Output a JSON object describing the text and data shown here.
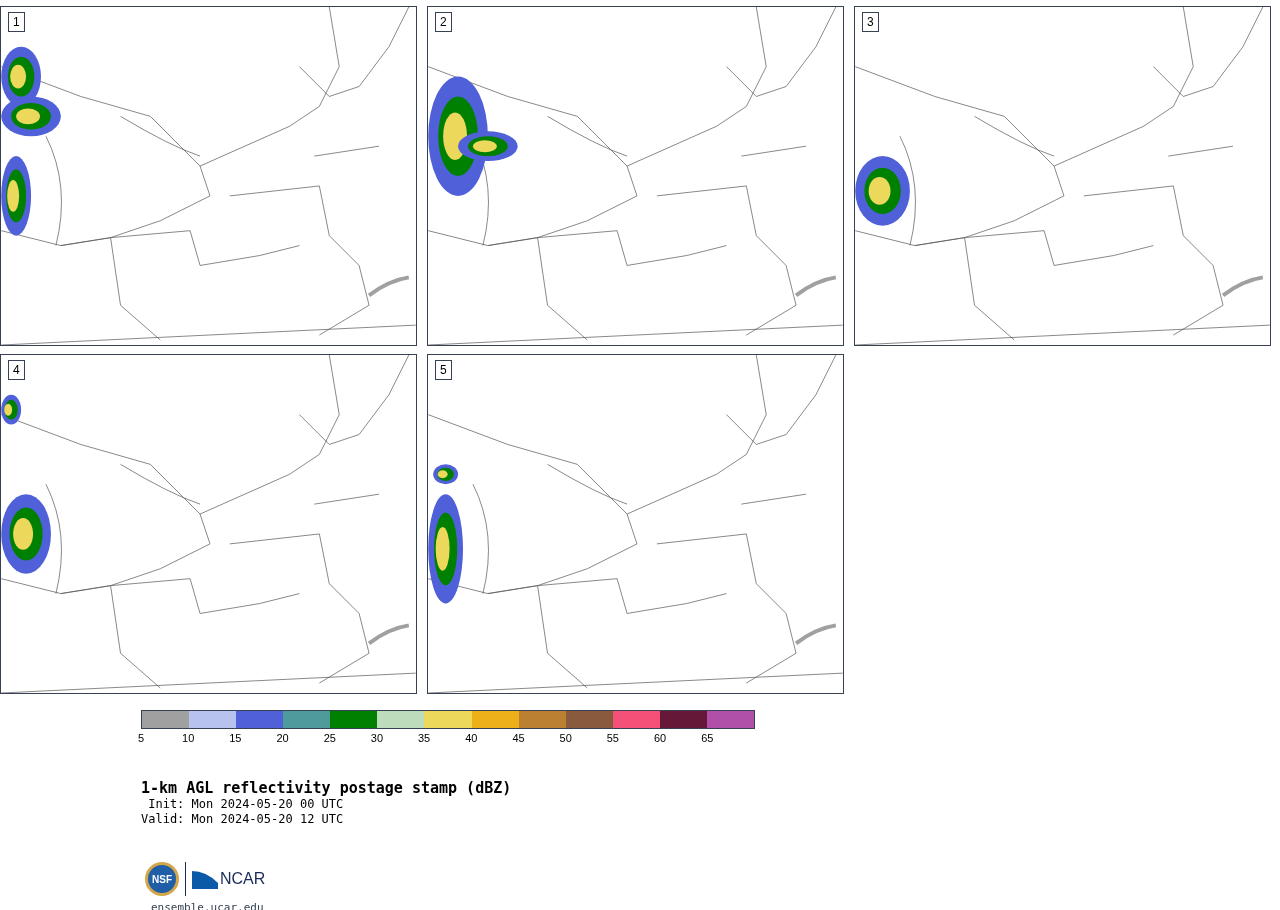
{
  "panels": [
    {
      "label": "1"
    },
    {
      "label": "2"
    },
    {
      "label": "3"
    },
    {
      "label": "4"
    },
    {
      "label": "5"
    }
  ],
  "colorbar": {
    "segments": [
      {
        "color": "#a0a0a0"
      },
      {
        "color": "#b8c2ee"
      },
      {
        "color": "#5060d8"
      },
      {
        "color": "#4f9a9a"
      },
      {
        "color": "#008000"
      },
      {
        "color": "#bcdcbc"
      },
      {
        "color": "#ecd85a"
      },
      {
        "color": "#eeb018"
      },
      {
        "color": "#bb8030"
      },
      {
        "color": "#8a5a3c"
      },
      {
        "color": "#f45078"
      },
      {
        "color": "#661838"
      },
      {
        "color": "#b050a8"
      }
    ],
    "ticks": [
      "5",
      "10",
      "15",
      "20",
      "25",
      "30",
      "35",
      "40",
      "45",
      "50",
      "55",
      "60",
      "65"
    ]
  },
  "title": "1-km AGL reflectivity postage stamp (dBZ)",
  "init": " Init: Mon 2024-05-20 00 UTC",
  "valid": "Valid: Mon 2024-05-20 12 UTC",
  "logo": {
    "nsf": "NSF",
    "ncar": "NCAR"
  },
  "footer": "ensemble.ucar.edu"
}
